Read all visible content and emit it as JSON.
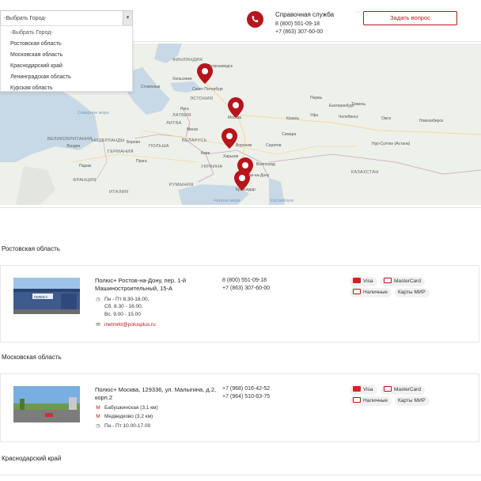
{
  "city_select": {
    "selected": "-Выбрать Город-",
    "options": [
      "-Выбрать Город-",
      "Ростовская область",
      "Московская область",
      "Краснодарский край",
      "Ленинградская область",
      "Курская область"
    ]
  },
  "help": {
    "title": "Справочная служба",
    "phone1": "8 (800) 551-09-18",
    "phone2": "+7 (863) 307-60-00",
    "ask_button": "Задать вопрос"
  },
  "map": {
    "labels": {
      "finland": "ФИНЛЯНДИЯ",
      "petrozavodsk": "Петрозаводск",
      "helsinki": "Хельсинки",
      "stockholm": "Стокгольм",
      "spb": "Санкт-Петербург",
      "estonia": "ЭСТОНИЯ",
      "riga": "Рига",
      "latvia": "ЛАТВИЯ",
      "lithuania": "ЛИТВА",
      "north_sea": "Северное море",
      "uk": "ВЕЛИКОБРИТАНИЯ",
      "london": "Лондон",
      "netherlands": "НИДЕРЛАНДЫ",
      "germany": "ГЕРМАНИЯ",
      "berlin": "Берлин",
      "poland": "ПОЛЬША",
      "belarus": "БЕЛАРУСЬ",
      "minsk": "Минск",
      "paris": "Париж",
      "france": "ФРАНЦИЯ",
      "prague": "Прага",
      "kyiv": "Киев",
      "ukraine": "УКРАИНА",
      "italy": "ИТАЛИЯ",
      "romania": "РУМЫНИЯ",
      "kharkiv": "Харьков",
      "moscow": "Москва",
      "voronezh": "Воронеж",
      "rostov": "Ростов-на-Дону",
      "krasnodar": "Краснодар",
      "volgograd": "Волгоград",
      "kazan": "Казань",
      "samara": "Самара",
      "saratov": "Саратов",
      "perm": "Пермь",
      "ekb": "Екатеринбург",
      "ufa": "Уфа",
      "tyumen": "Тюмень",
      "chelyabinsk": "Челябинск",
      "omsk": "Омск",
      "novosibirsk": "Новосибирск",
      "astana": "Нур-Султан (Астана)",
      "kazakhstan": "КАЗАХСТАН",
      "black_sea": "Черное море",
      "caspian": "Каспийское"
    }
  },
  "sections": [
    {
      "title": "Ростовская область",
      "card": {
        "title": "Полюс+ Ростов-на-Дону, пер. 1-й Машиностроительный, 15-А",
        "hours1": "Пн - Пт 8.30-18.00,",
        "hours2": "Сб. 8.30 - 16.00,",
        "hours3": "Вс. 9.00 - 15.00",
        "email": "inetmrkt@polusplus.ru",
        "phone1": "8 (800) 551-09-18",
        "phone2": "+7 (863) 307-60-00"
      }
    },
    {
      "title": "Московская область",
      "card": {
        "title": "Полюс+ Москва, 129336, ул. Малыгина, д.2, корп.2",
        "metro1": "Бабушкинская (3,1 км)",
        "metro2": "Медведково (3,2 км)",
        "hours1": "Пн - Пт 10.00-17.00",
        "phone1": "+7 (968) 016-42-52",
        "phone2": "+7 (964) 510-63-75"
      }
    },
    {
      "title": "Краснодарский край"
    }
  ],
  "payments": {
    "visa": "Visa",
    "mastercard": "MasterCard",
    "cash": "Наличные",
    "mir": "Карты МИР"
  },
  "colors": {
    "accent": "#b7141b",
    "map_land": "#eef0ea",
    "map_water": "#c7d8e6"
  }
}
